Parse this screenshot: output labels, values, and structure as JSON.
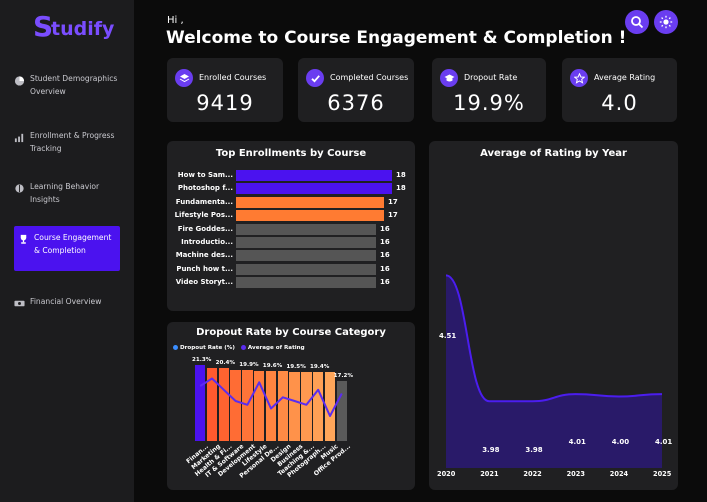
{
  "app": {
    "logo_s": "S",
    "logo_rest": "tudify"
  },
  "sidebar": {
    "items": [
      {
        "label": "Student Demographics Overview",
        "icon": "pie-chart-icon",
        "active": false
      },
      {
        "label": "Enrollment & Progress Tracking",
        "icon": "bar-progress-icon",
        "active": false
      },
      {
        "label": "Learning Behavior Insights",
        "icon": "brain-icon",
        "active": false
      },
      {
        "label": "Course Engagement & Completion",
        "icon": "trophy-icon",
        "active": true
      },
      {
        "label": "Financial Overview",
        "icon": "money-icon",
        "active": false
      }
    ]
  },
  "header": {
    "greeting": "Hi ,",
    "title": "Welcome to Course Engagement & Completion !"
  },
  "actions": {
    "search_icon": "search-icon",
    "theme_icon": "sun-icon"
  },
  "kpis": [
    {
      "label": "Enrolled Courses",
      "value": "9419",
      "icon": "layers-icon"
    },
    {
      "label": "Completed Courses",
      "value": "6376",
      "icon": "check-circle-icon"
    },
    {
      "label": "Dropout Rate",
      "value": "19.9%",
      "icon": "graduation-cap-icon"
    },
    {
      "label": "Average Rating",
      "value": "4.0",
      "icon": "star-badge-icon"
    }
  ],
  "colors": {
    "accent": "#4b12ef",
    "orange": "#ff7b32",
    "gray_bar": "#555555",
    "purple_line": "#5b2cf0"
  },
  "chart_data": [
    {
      "type": "bar",
      "orientation": "horizontal",
      "title": "Top Enrollments by Course",
      "categories": [
        "How to Sam...",
        "Photoshop f...",
        "Fundamenta...",
        "Lifestyle Pos...",
        "Fire Goddes...",
        "Introductio...",
        "Machine des...",
        "Punch how t...",
        "Video Storyt..."
      ],
      "values": [
        18,
        18,
        17,
        17,
        16,
        16,
        16,
        16,
        16
      ],
      "bar_colors": [
        "#4b12ef",
        "#4b12ef",
        "#ff7b32",
        "#ff7b32",
        "#555555",
        "#555555",
        "#555555",
        "#555555",
        "#555555"
      ],
      "xlim": [
        0,
        18
      ]
    },
    {
      "type": "bar",
      "title": "Dropout Rate by Course Category",
      "legend": [
        "Dropout Rate (%)",
        "Average of Rating"
      ],
      "legend_colors": [
        "#3a8dff",
        "#5b2cf0"
      ],
      "categories": [
        "Finan...",
        "Marketing",
        "Health & Fi...",
        "IT & Software",
        "Development",
        "Lifestyle",
        "Personal De...",
        "Design",
        "Business",
        "Teaching &...",
        "Photograph...",
        "Music",
        "Office Prod..."
      ],
      "series": [
        {
          "name": "Dropout Rate (%)",
          "values": [
            21.3,
            20.6,
            20.4,
            20.1,
            19.9,
            19.8,
            19.6,
            19.6,
            19.5,
            19.5,
            19.4,
            19.4,
            17.2
          ]
        },
        {
          "name": "Average of Rating",
          "values": [
            4.2,
            4.3,
            4.15,
            4.0,
            3.95,
            4.25,
            3.9,
            4.05,
            4.0,
            3.95,
            4.15,
            3.8,
            4.1
          ]
        }
      ],
      "data_labels": [
        "21.3%",
        "",
        "20.4%",
        "",
        "19.9%",
        "",
        "19.6%",
        "",
        "19.5%",
        "",
        "19.4%",
        "",
        "17.2%"
      ],
      "bar_colors": [
        "#4b12ef",
        "#ff5a2e",
        "#ff6330",
        "#ff6c34",
        "#ff7438",
        "#ff7c3c",
        "#ff8440",
        "#ff8b45",
        "#ff924a",
        "#ff9950",
        "#ffa055",
        "#ffa65a",
        "#5a5a5a"
      ],
      "ylim": [
        0,
        22
      ]
    },
    {
      "type": "area",
      "title": "Average of Rating by Year",
      "x": [
        "2020",
        "2021",
        "2022",
        "2023",
        "2024",
        "2025"
      ],
      "y": [
        4.51,
        3.98,
        3.98,
        4.01,
        4.0,
        4.01
      ],
      "data_labels": [
        "4.51",
        "3.98",
        "3.98",
        "4.01",
        "4.00",
        "4.01"
      ],
      "ylim": [
        3.8,
        4.6
      ]
    }
  ]
}
